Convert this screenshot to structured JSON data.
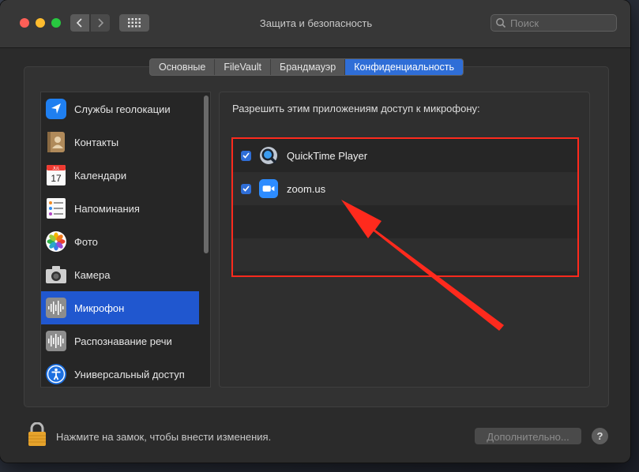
{
  "window": {
    "title": "Защита и безопасность"
  },
  "search": {
    "placeholder": "Поиск"
  },
  "tabs": [
    {
      "label": "Основные",
      "active": false
    },
    {
      "label": "FileVault",
      "active": false
    },
    {
      "label": "Брандмауэр",
      "active": false
    },
    {
      "label": "Конфиденциальность",
      "active": true
    }
  ],
  "sidebar": {
    "selected_index": 6,
    "items": [
      {
        "label": "Службы геолокации",
        "icon": "location-arrow-icon"
      },
      {
        "label": "Контакты",
        "icon": "contacts-book-icon"
      },
      {
        "label": "Календари",
        "icon": "calendar-icon"
      },
      {
        "label": "Напоминания",
        "icon": "reminders-list-icon"
      },
      {
        "label": "Фото",
        "icon": "photos-flower-icon"
      },
      {
        "label": "Камера",
        "icon": "camera-icon"
      },
      {
        "label": "Микрофон",
        "icon": "microphone-waveform-icon"
      },
      {
        "label": "Распознавание речи",
        "icon": "speech-waveform-icon"
      },
      {
        "label": "Универсальный доступ",
        "icon": "accessibility-icon"
      }
    ]
  },
  "main": {
    "permission_text": "Разрешить этим приложениям доступ к микрофону:",
    "apps": [
      {
        "name": "QuickTime Player",
        "checked": true,
        "icon": "quicktime-icon"
      },
      {
        "name": "zoom.us",
        "checked": true,
        "icon": "zoom-camera-icon"
      }
    ]
  },
  "calendar_icon": {
    "month": "JUL",
    "day": "17"
  },
  "footer": {
    "lock_text": "Нажмите на замок, чтобы внести изменения.",
    "advanced_label": "Дополнительно...",
    "help_label": "?"
  },
  "colors": {
    "accent": "#2f6ed7",
    "selection": "#2057cf",
    "highlight_red": "#ff2a1d"
  }
}
